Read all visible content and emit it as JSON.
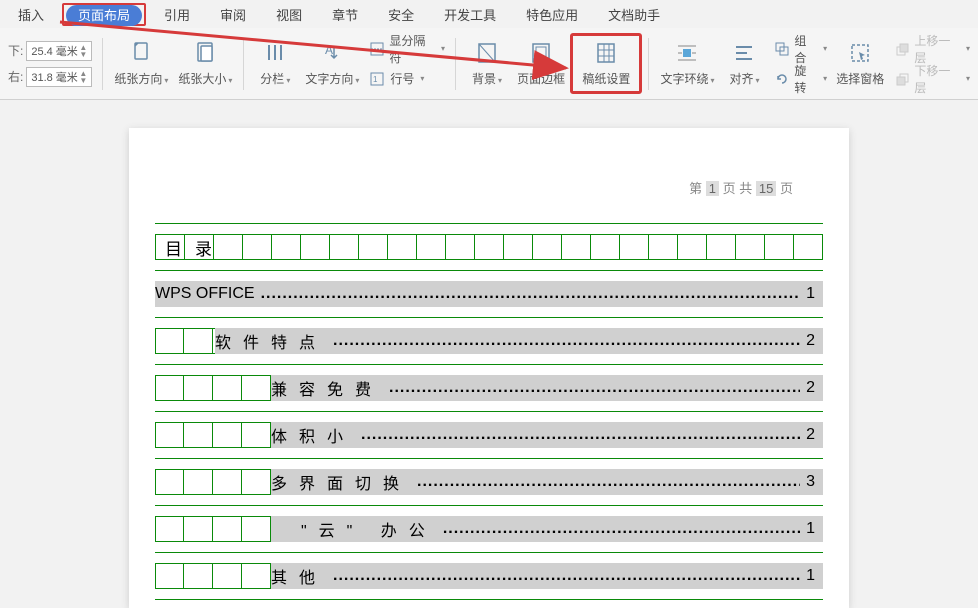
{
  "tabs": {
    "insert": "插入",
    "pageLayout": "页面布局",
    "reference": "引用",
    "review": "审阅",
    "view": "视图",
    "chapter": "章节",
    "security": "安全",
    "devtools": "开发工具",
    "specialApp": "特色应用",
    "docHelper": "文档助手"
  },
  "margins": {
    "topLabel": "下:",
    "topVal": "25.4 毫米",
    "bottomLabel": "右:",
    "bottomVal": "31.8 毫米"
  },
  "ribbon": {
    "orientation": "纸张方向",
    "size": "纸张大小",
    "columns": "分栏",
    "textDir": "文字方向",
    "lineNumPrefix": "显分隔符",
    "lineNum": "行号",
    "background": "背景",
    "pageBorder": "页面边框",
    "manuscript": "稿纸设置",
    "textWrap": "文字环绕",
    "align": "对齐",
    "group": "组合",
    "rotate": "旋转",
    "selectPane": "选择窗格",
    "moveUp": "上移一层",
    "moveDown": "下移一层"
  },
  "pageHeader": {
    "p1": "第",
    "p2": "页 共",
    "p3": "页",
    "curPage": "1",
    "totalPages": "15"
  },
  "tocHeading": {
    "c1": "目",
    "c2": "录"
  },
  "toc": [
    {
      "title": "WPS OFFICE",
      "page": "1",
      "indent": 1,
      "cn": false
    },
    {
      "title": "软件特点",
      "page": "2",
      "indent": 2,
      "cn": true,
      "cellsLeft": 2
    },
    {
      "title": "兼容免费",
      "page": "2",
      "indent": 3,
      "cn": true,
      "cellsLeft": 4
    },
    {
      "title": "体积小",
      "page": "2",
      "indent": 3,
      "cn": true,
      "cellsLeft": 4
    },
    {
      "title": "多界面切换",
      "page": "3",
      "indent": 3,
      "cn": true,
      "cellsLeft": 4
    },
    {
      "title": "\"云\" 办公",
      "page": "1",
      "indent": 3,
      "cn": true,
      "cellsLeft": 4,
      "titleIndent": 5
    },
    {
      "title": "其他",
      "page": "1",
      "indent": 3,
      "cn": true,
      "cellsLeft": 4
    }
  ],
  "dots": "............................................................................................................................................................"
}
